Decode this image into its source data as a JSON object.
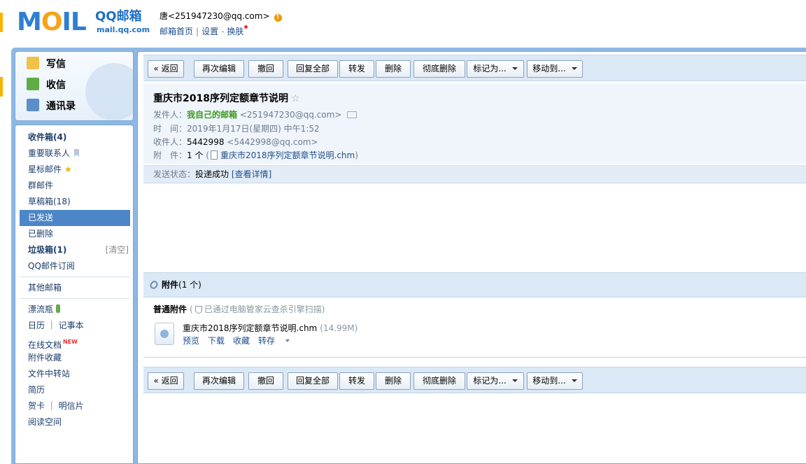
{
  "header": {
    "logo_text": "MOIL",
    "logo_qq": "QQ邮箱",
    "logo_site": "mail.qq.com",
    "user": "唐<251947230@qq.com>",
    "user_alert": "!",
    "links": [
      "邮箱首页",
      "设置",
      "换肤"
    ],
    "link_sep": "|",
    "link_dash": "-"
  },
  "sidebar": {
    "top_items": [
      {
        "label": "写信",
        "icon": "compose-icon"
      },
      {
        "label": "收信",
        "icon": "inbox-download-icon"
      },
      {
        "label": "通讯录",
        "icon": "contacts-icon"
      }
    ],
    "folders": [
      {
        "label": "收件箱(4)",
        "bold": true
      },
      {
        "label": "重要联系人",
        "icon": "bookmark-icon"
      },
      {
        "label": "星标邮件",
        "icon": "star-icon",
        "star": "★"
      },
      {
        "label": "群邮件"
      },
      {
        "label": "草稿箱(18)"
      },
      {
        "label": "已发送",
        "active": true
      },
      {
        "label": "已删除"
      },
      {
        "label": "垃圾箱(1)",
        "bold": true,
        "right": "[清空]"
      },
      {
        "label": "QQ邮件订阅"
      }
    ],
    "other": "其他邮箱",
    "apps": [
      {
        "label": "漂流瓶"
      },
      {
        "label": "日历 ｜ 记事本"
      },
      {
        "label": "在线文档",
        "badge": "NEW"
      },
      {
        "label": "附件收藏"
      },
      {
        "label": "文件中转站"
      },
      {
        "label": "简历"
      },
      {
        "label": "贺卡 ｜ 明信片"
      },
      {
        "label": "阅读空间"
      }
    ]
  },
  "toolbar": {
    "back": "« 返回",
    "edit_again": "再次编辑",
    "recall": "撤回",
    "reply_all": "回复全部",
    "forward": "转发",
    "delete": "删除",
    "delete_forever": "彻底删除",
    "mark_as": "标记为...",
    "move_to": "移动到..."
  },
  "mail": {
    "subject": "重庆市2018序列定额章节说明",
    "star": "☆",
    "from_label": "发件人：",
    "from_name": "我自己的邮箱",
    "from_addr": "<251947230@qq.com>",
    "time_label": "时　间：",
    "time": "2019年1月17日(星期四) 中午1:52",
    "to_label": "收件人：",
    "to_name": "5442998",
    "to_addr": "<5442998@qq.com>",
    "att_label": "附　件：",
    "att_count": "1 个",
    "att_open": "(",
    "att_close": ")",
    "att_name": "重庆市2018序列定额章节说明.chm",
    "status_label": "发送状态：",
    "status_value": "投递成功",
    "status_detail": "[查看详情]"
  },
  "attachments": {
    "title": "附件",
    "count": "(1 个)",
    "section": "普通附件",
    "scan_open": "(",
    "scan": "已通过电脑管家云查杀引擎扫描",
    "scan_close": ")",
    "file_name": "重庆市2018序列定额章节说明.chm",
    "file_size": "(14.99M)",
    "actions": [
      "预览",
      "下载",
      "收藏",
      "转存"
    ]
  },
  "colors": {
    "frame": "#8db8e4",
    "active_folder": "#4c86c8",
    "link": "#1d4d8c",
    "sender_green": "#3c9a1e"
  }
}
